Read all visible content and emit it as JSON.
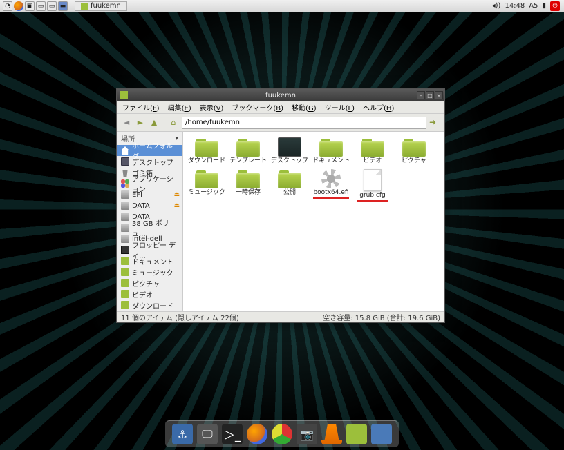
{
  "panel": {
    "task_label": "fuukemn",
    "vol_indicator": "◂))",
    "time": "14:48",
    "ime": "A5"
  },
  "window": {
    "title": "fuukemn",
    "menus": [
      {
        "label": "ファイル",
        "u": "F"
      },
      {
        "label": "編集",
        "u": "E"
      },
      {
        "label": "表示",
        "u": "V"
      },
      {
        "label": "ブックマーク",
        "u": "B"
      },
      {
        "label": "移動",
        "u": "G"
      },
      {
        "label": "ツール",
        "u": "L"
      },
      {
        "label": "ヘルプ",
        "u": "H"
      }
    ],
    "path": "/home/fuukemn",
    "sidebar": {
      "header": "場所",
      "items": [
        {
          "label": "ホームフォルダ",
          "icon": "home-sel",
          "sel": true
        },
        {
          "label": "デスクトップ",
          "icon": "monitor"
        },
        {
          "label": "ゴミ箱",
          "icon": "trash"
        },
        {
          "label": "アプリケーション",
          "icon": "appgrid"
        },
        {
          "label": "EFI",
          "icon": "disk",
          "eject": true
        },
        {
          "label": "DATA",
          "icon": "disk",
          "eject": true
        },
        {
          "label": "DATA",
          "icon": "disk"
        },
        {
          "label": "38 GB ボリュ...",
          "icon": "disk"
        },
        {
          "label": "intel-dell",
          "icon": "disk"
        },
        {
          "label": "フロッピー ディ...",
          "icon": "floppy"
        },
        {
          "label": "ドキュメント",
          "icon": "folder"
        },
        {
          "label": "ミュージック",
          "icon": "folder"
        },
        {
          "label": "ピクチャ",
          "icon": "folder"
        },
        {
          "label": "ビデオ",
          "icon": "folder"
        },
        {
          "label": "ダウンロード",
          "icon": "folder"
        }
      ]
    },
    "items": [
      {
        "label": "ダウンロード",
        "type": "folder"
      },
      {
        "label": "テンプレート",
        "type": "folder"
      },
      {
        "label": "デスクトップ",
        "type": "desktop"
      },
      {
        "label": "ドキュメント",
        "type": "folder"
      },
      {
        "label": "ビデオ",
        "type": "folder"
      },
      {
        "label": "ピクチャ",
        "type": "folder"
      },
      {
        "label": "ミュージック",
        "type": "folder"
      },
      {
        "label": "一時保存",
        "type": "folder"
      },
      {
        "label": "公開",
        "type": "folder"
      },
      {
        "label": "bootx64.efi",
        "type": "gear",
        "hl": true
      },
      {
        "label": "grub.cfg",
        "type": "file",
        "hl": true
      }
    ],
    "status_left": "11 個のアイテム (隠しアイテム 22個)",
    "status_right": "空き容量: 15.8 GiB (合計: 19.6 GiB)"
  }
}
